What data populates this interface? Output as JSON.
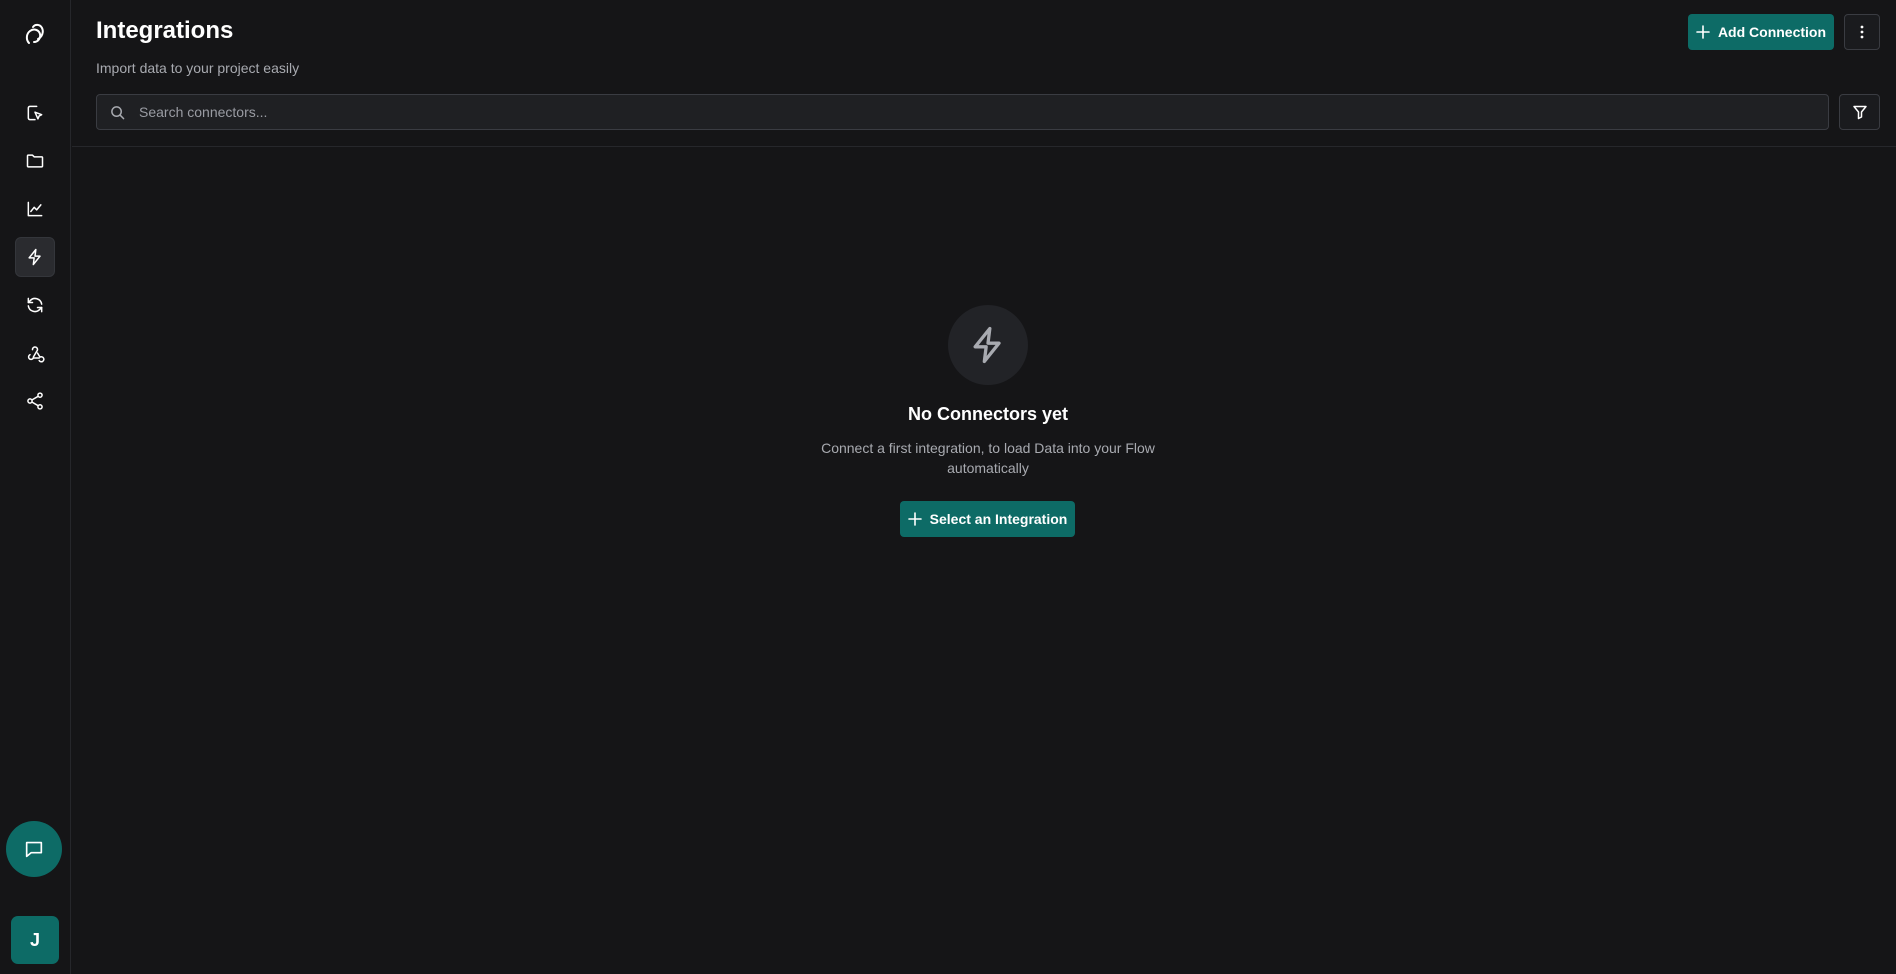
{
  "header": {
    "title": "Integrations",
    "subtitle": "Import data to your project easily",
    "add_connection_label": "Add Connection",
    "search_placeholder": "Search connectors..."
  },
  "sidebar": {
    "items": [
      {
        "icon": "cursor-select-icon",
        "active": false
      },
      {
        "icon": "folder-icon",
        "active": false
      },
      {
        "icon": "line-chart-icon",
        "active": false
      },
      {
        "icon": "lightning-icon",
        "active": true
      },
      {
        "icon": "refresh-icon",
        "active": false
      },
      {
        "icon": "webhook-icon",
        "active": false
      },
      {
        "icon": "share-icon",
        "active": false
      }
    ],
    "avatar_initial": "J"
  },
  "empty_state": {
    "icon": "lightning-icon",
    "title": "No Connectors yet",
    "description": "Connect a first integration, to load Data into your Flow automatically",
    "button_label": "Select an Integration"
  },
  "colors": {
    "background": "#151517",
    "accent": "#0d6b66",
    "border": "#26272b",
    "muted_text": "#a8aab0"
  }
}
